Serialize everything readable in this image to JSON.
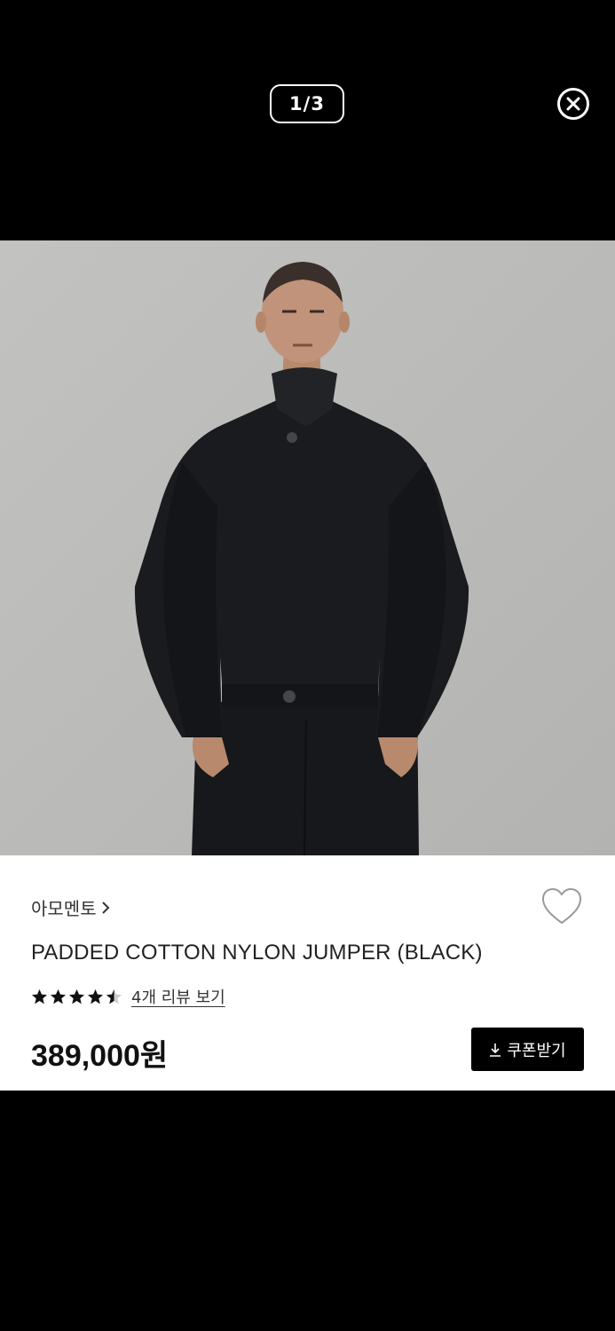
{
  "viewer": {
    "page_indicator": "1/3",
    "close_icon": "close-circle-icon"
  },
  "product": {
    "brand": "아모멘토",
    "name": "PADDED COTTON NYLON JUMPER (BLACK)",
    "rating": 4.5,
    "review_link": "4개 리뷰 보기",
    "price": "389,000원",
    "coupon_button": "쿠폰받기"
  },
  "colors": {
    "background": "#000000",
    "photo_background": "#b9b9b7",
    "jacket": "#1a1b1e",
    "card": "#ffffff",
    "button": "#000000"
  }
}
